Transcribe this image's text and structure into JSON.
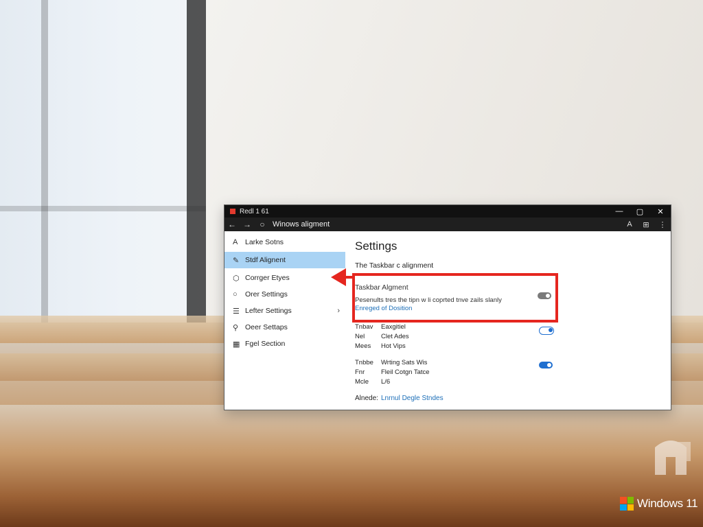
{
  "window": {
    "title": "Redl 1 61",
    "address": "Winows aligment",
    "controls": [
      "—",
      "▢",
      "✕"
    ]
  },
  "sidebar": {
    "items": [
      {
        "icon": "person-icon",
        "glyph": "A",
        "label": "Larke Sotns"
      },
      {
        "icon": "pen-icon",
        "glyph": "✎",
        "label": "Stdf Alignent",
        "selected": true
      },
      {
        "icon": "shape-icon",
        "glyph": "⬡",
        "label": "Corrger Etyes"
      },
      {
        "icon": "circle-icon",
        "glyph": "○",
        "label": "Orer Settings"
      },
      {
        "icon": "list-icon",
        "glyph": "☰",
        "label": "Lefter Settings",
        "chevron": "›"
      },
      {
        "icon": "key-icon",
        "glyph": "⚲",
        "label": "Oeer Settaps"
      },
      {
        "icon": "grid-icon",
        "glyph": "▦",
        "label": "Fgel Section"
      }
    ]
  },
  "content": {
    "page_title": "Settings",
    "breadcrumb": "The Taskbar c alignment",
    "setting": {
      "title": "Taskbar Algment",
      "description": "Pesenults tres the tipn w li coprted tnve zails slanly",
      "link": "Enreged of Dosition",
      "toggle": "off"
    },
    "rows_a": [
      {
        "key": "Tnbav",
        "value": "Eaxgitiel"
      },
      {
        "key": "Nel",
        "value": "Clet Ades"
      },
      {
        "key": "Mees",
        "value": "Hot Vips"
      }
    ],
    "toggle_a": "on",
    "rows_b": [
      {
        "key": "Tnbbe",
        "value": "Wrting Sats Wis"
      },
      {
        "key": "Fnr",
        "value": "Fleil Cotgn Tatce"
      },
      {
        "key": "Mcle",
        "value": "L/6"
      }
    ],
    "toggle_b": "on",
    "footer": {
      "key": "Alnede:",
      "value": "Lnrnul Degle Stndes"
    }
  },
  "brand": {
    "text": "Windows 11",
    "colors": [
      "#f25022",
      "#7fba00",
      "#00a4ef",
      "#ffb900"
    ]
  },
  "accent": "#e5261f"
}
